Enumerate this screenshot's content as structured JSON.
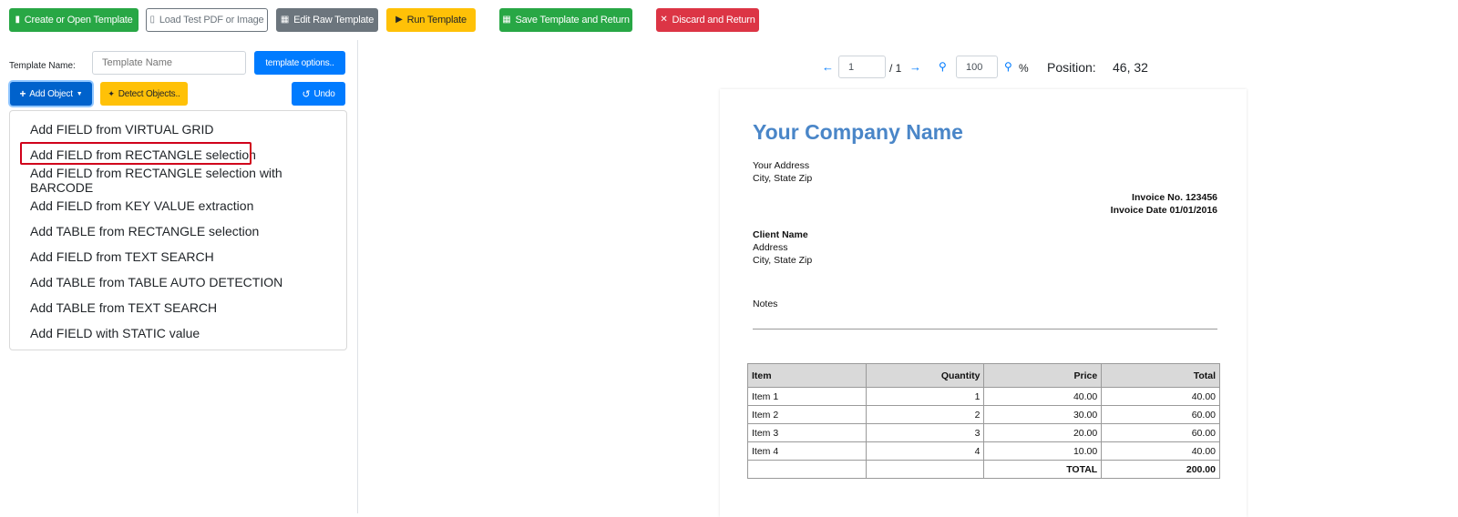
{
  "toolbar": {
    "create": "Create or Open Template",
    "load": "Load Test PDF or Image",
    "edit": "Edit Raw Template",
    "run": "Run Template",
    "save": "Save Template and Return",
    "discard": "Discard and Return"
  },
  "left": {
    "template_name_label": "Template Name:",
    "template_name_placeholder": "Template Name",
    "template_options": "template options..",
    "add_object": "Add Object",
    "detect_objects": "Detect Objects..",
    "undo": "Undo",
    "menu": [
      "Add FIELD from VIRTUAL GRID",
      "Add FIELD from RECTANGLE selection",
      "Add FIELD from RECTANGLE selection with BARCODE",
      "Add FIELD from KEY VALUE extraction",
      "Add TABLE from RECTANGLE selection",
      "Add FIELD from TEXT SEARCH",
      "Add TABLE from TABLE AUTO DETECTION",
      "Add TABLE from TEXT SEARCH",
      "Add FIELD with STATIC value"
    ]
  },
  "viewer": {
    "page_value": "1",
    "page_total": "/ 1",
    "zoom_value": "100",
    "zoom_unit": "%",
    "position_label": "Position:",
    "position_value": "46, 32"
  },
  "document": {
    "company": "Your Company Name",
    "address1": "Your Address",
    "address2": "City, State Zip",
    "invoice_no": "Invoice No. 123456",
    "invoice_date": "Invoice Date 01/01/2016",
    "client_name": "Client Name",
    "client_address": "Address",
    "client_city": "City, State Zip",
    "notes": "Notes",
    "table": {
      "headers": [
        "Item",
        "Quantity",
        "Price",
        "Total"
      ],
      "rows": [
        [
          "Item 1",
          "1",
          "40.00",
          "40.00"
        ],
        [
          "Item 2",
          "2",
          "30.00",
          "60.00"
        ],
        [
          "Item 3",
          "3",
          "20.00",
          "60.00"
        ],
        [
          "Item 4",
          "4",
          "10.00",
          "40.00"
        ],
        [
          "",
          "",
          "TOTAL",
          "200.00"
        ]
      ]
    }
  },
  "colors": {
    "green": "#28a745",
    "gray": "#6c757d",
    "yellow": "#ffc107",
    "red": "#dc3545",
    "blue": "#007bff",
    "company_blue": "#4a86c8",
    "highlight_red": "#d0021b"
  }
}
